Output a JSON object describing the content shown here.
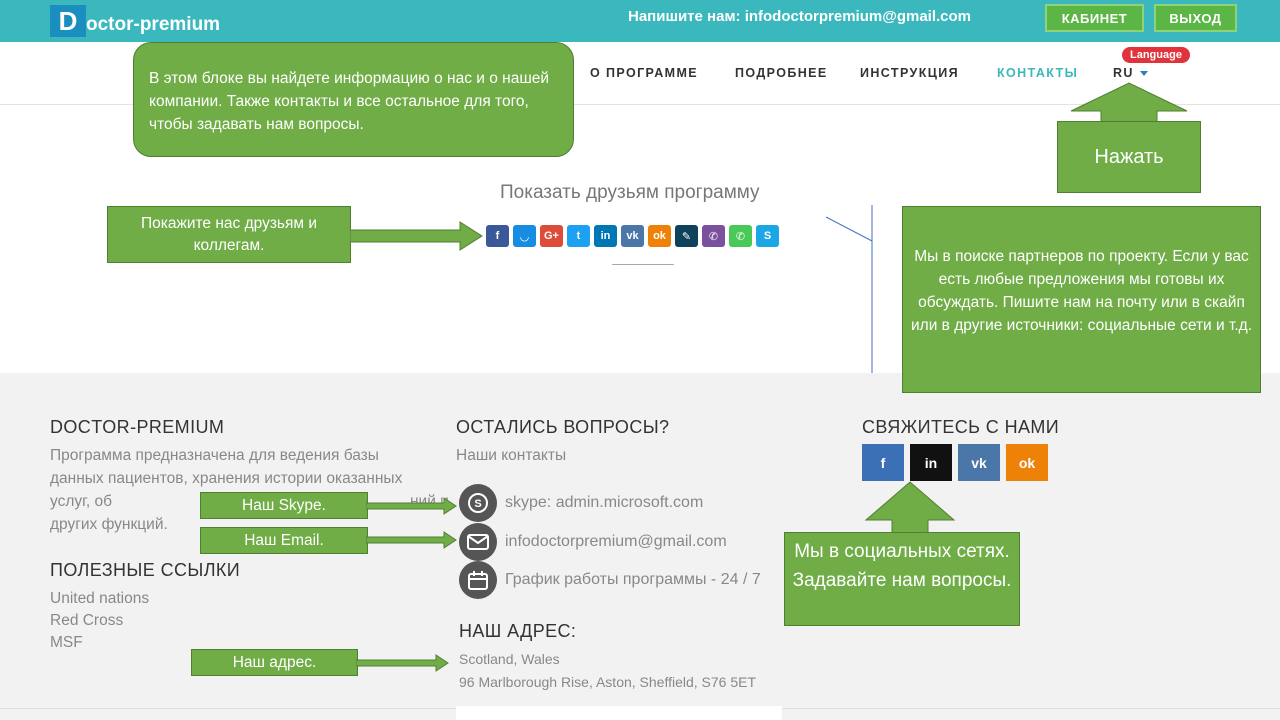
{
  "header": {
    "logo_letter": "D",
    "logo_text": "octor-premium",
    "contact_line": "Напишите нам: infodoctorpremium@gmail.com",
    "cabinet_button": "КАБИНЕТ",
    "logout_button": "ВЫХОД"
  },
  "nav": {
    "items": [
      "О ПРОГРАММЕ",
      "ПОДРОБНЕЕ",
      "ИНСТРУКЦИЯ",
      "КОНТАКТЫ"
    ],
    "lang": "RU",
    "language_badge": "Language"
  },
  "callouts": {
    "about": "В этом блоке вы найдете информацию о нас и о нашей компании. Также контакты и все остальное для того, чтобы задавать нам вопросы.",
    "press": "Нажать",
    "share": "Покажите нас друзьям и коллегам.",
    "partners": "Мы в поиске партнеров по проекту. Если у вас есть любые предложения мы готовы их обсуждать. Пишите нам на почту или в скайп или в другие источники: социальные сети и т.д.",
    "skype": "Наш Skype.",
    "email": "Наш Email.",
    "social": "Мы в социальных сетях. Задавайте нам вопросы.",
    "address": "Наш адрес."
  },
  "share": {
    "title": "Показать друзьям программу",
    "icons": [
      {
        "name": "facebook-share-icon",
        "glyph": "f",
        "color": "#3b5998"
      },
      {
        "name": "myworld-share-icon",
        "glyph": "◡",
        "color": "#168de2"
      },
      {
        "name": "googleplus-share-icon",
        "glyph": "G+",
        "color": "#dd4b39"
      },
      {
        "name": "twitter-share-icon",
        "glyph": "t",
        "color": "#1da1f2"
      },
      {
        "name": "linkedin-share-icon",
        "glyph": "in",
        "color": "#0077b5"
      },
      {
        "name": "vk-share-icon",
        "glyph": "vk",
        "color": "#4a76a8"
      },
      {
        "name": "odnoklassniki-share-icon",
        "glyph": "ok",
        "color": "#ee8208"
      },
      {
        "name": "livejournal-share-icon",
        "glyph": "✎",
        "color": "#0d425a"
      },
      {
        "name": "viber-share-icon",
        "glyph": "✆",
        "color": "#7b519d"
      },
      {
        "name": "whatsapp-share-icon",
        "glyph": "✆",
        "color": "#4ac959"
      },
      {
        "name": "skype-share-icon",
        "glyph": "S",
        "color": "#1ba6e6"
      }
    ]
  },
  "footer": {
    "brand_heading": "DOCTOR-PREMIUM",
    "brand_text": "Программа предназначена для ведения базы данных пациентов, хранения истории оказанных услуг, об",
    "brand_text_tail": "ний и",
    "brand_text_last": "других функций.",
    "links_heading": "ПОЛЕЗНЫЕ ССЫЛКИ",
    "links": [
      "United nations",
      "Red Cross",
      "MSF"
    ],
    "questions_heading": "ОСТАЛИСЬ ВОПРОСЫ?",
    "contacts_label": "Наши контакты",
    "skype": "skype: admin.microsoft.com",
    "email": "infodoctorpremium@gmail.com",
    "schedule": "График работы программы - 24 / 7",
    "address_heading": "НАШ АДРЕС:",
    "address_line1": "Scotland, Wales",
    "address_line2": "96 Marlborough Rise, Aston, Sheffield, S76 5ET",
    "contact_heading": "СВЯЖИТЕСЬ С НАМИ",
    "social": [
      {
        "name": "facebook-link-icon",
        "glyph": "f",
        "color": "#3b6fb6"
      },
      {
        "name": "linkedin-link-icon",
        "glyph": "in",
        "color": "#111111"
      },
      {
        "name": "vk-link-icon",
        "glyph": "vk",
        "color": "#4a76a8"
      },
      {
        "name": "odnoklassniki-link-icon",
        "glyph": "ok",
        "color": "#ee8208"
      }
    ]
  },
  "colors": {
    "topbar": "#3bb8bd",
    "callout_green": "#70ad47",
    "button_green": "#5cb646",
    "accent_nav": "#3bb8bd",
    "badge_red": "#e0333c"
  }
}
